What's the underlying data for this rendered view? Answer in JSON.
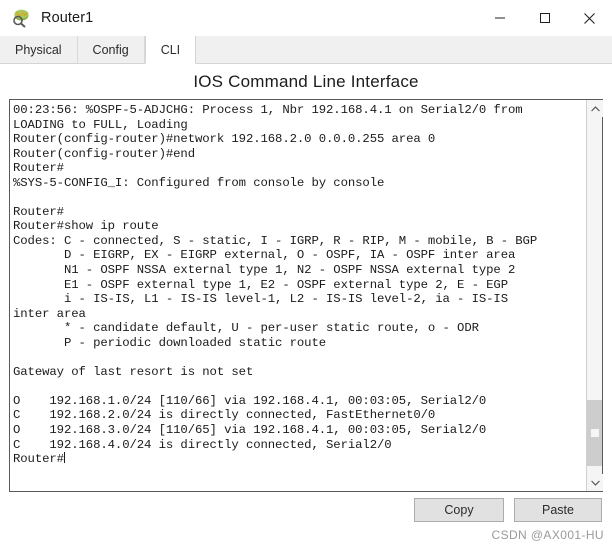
{
  "window": {
    "title": "Router1",
    "icon": "router-device-icon",
    "controls": [
      {
        "name": "minimize",
        "glyph": "minimize-icon"
      },
      {
        "name": "maximize",
        "glyph": "maximize-icon"
      },
      {
        "name": "close",
        "glyph": "close-icon"
      }
    ]
  },
  "tabs": [
    {
      "label": "Physical",
      "active": false
    },
    {
      "label": "Config",
      "active": false
    },
    {
      "label": "CLI",
      "active": true
    }
  ],
  "panel": {
    "heading": "IOS Command Line Interface"
  },
  "terminal": {
    "lines": [
      "00:23:56: %OSPF-5-ADJCHG: Process 1, Nbr 192.168.4.1 on Serial2/0 from",
      "LOADING to FULL, Loading",
      "Router(config-router)#network 192.168.2.0 0.0.0.255 area 0",
      "Router(config-router)#end",
      "Router#",
      "%SYS-5-CONFIG_I: Configured from console by console",
      "",
      "Router#",
      "Router#show ip route",
      "Codes: C - connected, S - static, I - IGRP, R - RIP, M - mobile, B - BGP",
      "       D - EIGRP, EX - EIGRP external, O - OSPF, IA - OSPF inter area",
      "       N1 - OSPF NSSA external type 1, N2 - OSPF NSSA external type 2",
      "       E1 - OSPF external type 1, E2 - OSPF external type 2, E - EGP",
      "       i - IS-IS, L1 - IS-IS level-1, L2 - IS-IS level-2, ia - IS-IS",
      "inter area",
      "       * - candidate default, U - per-user static route, o - ODR",
      "       P - periodic downloaded static route",
      "",
      "Gateway of last resort is not set",
      "",
      "O    192.168.1.0/24 [110/66] via 192.168.4.1, 00:03:05, Serial2/0",
      "C    192.168.2.0/24 is directly connected, FastEthernet0/0",
      "O    192.168.3.0/24 [110/65] via 192.168.4.1, 00:03:05, Serial2/0",
      "C    192.168.4.0/24 is directly connected, Serial2/0"
    ],
    "prompt": "Router#",
    "scrollbar": {
      "up_arrow": "chevron-up-icon",
      "down_arrow": "chevron-down-icon"
    }
  },
  "footer": {
    "copy_label": "Copy",
    "paste_label": "Paste"
  },
  "watermark": "CSDN @AX001-HU",
  "colors": {
    "tab_bar": "#f0f0f0",
    "button_face": "#e1e1e1",
    "terminal_border": "#5a5a5a",
    "text": "#1b1b1b"
  }
}
